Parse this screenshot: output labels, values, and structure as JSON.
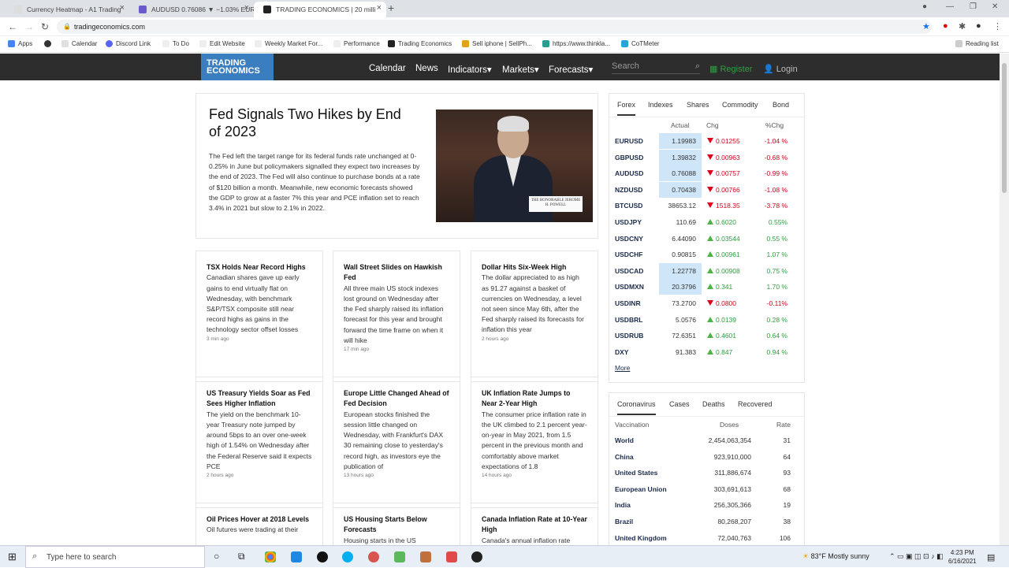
{
  "browser": {
    "tabs": [
      {
        "title": "Currency Heatmap - A1 Trading"
      },
      {
        "title": "AUDUSD 0.76086 ▼ −1.03% EUR"
      },
      {
        "title": "TRADING ECONOMICS | 20 milli"
      }
    ],
    "url": "tradingeconomics.com",
    "bookmarks": [
      "Apps",
      "Calendar",
      "Discord Link",
      "To Do",
      "Edit Website",
      "Weekly Market For...",
      "Performance",
      "Trading Economics",
      "Sell iphone | SellPh...",
      "https://www.thinkla...",
      "CoTMeter",
      "Reading list"
    ]
  },
  "site": {
    "logo_line1": "TRADING",
    "logo_line2": "ECONOMICS",
    "nav": [
      "Calendar",
      "News",
      "Indicators",
      "Markets",
      "Forecasts"
    ],
    "search_placeholder": "Search",
    "register": "Register",
    "login": "Login"
  },
  "headline": {
    "title": "Fed Signals Two Hikes by End of 2023",
    "body": "The Fed left the target range for its federal funds rate unchanged at 0-0.25% in June but policymakers signalled they expect two increases by the end of 2023. The Fed will also continue to purchase bonds at a rate of $120 billion a month. Meanwhile, new economic forecasts showed the GDP to grow at a faster 7% this year and PCE inflation set to reach 3.4% in 2021 but slow to 2.1% in 2022.",
    "nameplate": "THE HONORABLE JEROME H. POWELL"
  },
  "cards": [
    {
      "title": "TSX Holds Near Record Highs",
      "body": "Canadian shares gave up early gains to end virtually flat on Wednesday, with benchmark S&P/TSX composite still near record highs as gains in the technology sector offset losses",
      "ago": "3 min ago"
    },
    {
      "title": "Wall Street Slides on Hawkish Fed",
      "body": "All three main US stock indexes lost ground on Wednesday after the Fed sharply raised its inflation forecast for this year and brought forward the time frame on when it will hike",
      "ago": "17 min ago"
    },
    {
      "title": "Dollar Hits Six-Week High",
      "body": "The dollar appreciated to as high as 91.27 against a basket of currencies on Wednesday, a level not seen since May 6th, after the Fed sharply raised its forecasts for inflation this year",
      "ago": "2 hours ago"
    },
    {
      "title": "US Treasury Yields Soar as Fed Sees Higher Inflation",
      "body": "The yield on the benchmark 10-year Treasury note jumped by around 5bps to an over one-week high of 1.54% on Wednesday after the Federal Reserve said it expects PCE",
      "ago": "2 hours ago"
    },
    {
      "title": "Europe Little Changed Ahead of Fed Decision",
      "body": "European stocks finished the session little changed on Wednesday, with Frankfurt's DAX 30 remaining close to yesterday's record high, as investors eye the publication of",
      "ago": "13 hours ago"
    },
    {
      "title": "UK Inflation Rate Jumps to Near 2-Year High",
      "body": "The consumer price inflation rate in the UK climbed to 2.1 percent year-on-year in May 2021, from 1.5 percent in the previous month and comfortably above market expectations of 1.8",
      "ago": "14 hours ago"
    },
    {
      "title": "Oil Prices Hover at 2018 Levels",
      "body": "Oil futures were trading at their",
      "ago": ""
    },
    {
      "title": "US Housing Starts Below Forecasts",
      "body": "Housing starts in the US",
      "ago": ""
    },
    {
      "title": "Canada Inflation Rate at 10-Year High",
      "body": "Canada's annual inflation rate",
      "ago": ""
    }
  ],
  "forex": {
    "tabs": [
      "Forex",
      "Indexes",
      "Shares",
      "Commodity",
      "Bond"
    ],
    "columns": [
      "Actual",
      "Chg",
      "%Chg"
    ],
    "rows": [
      {
        "sym": "EURUSD",
        "actual": "1.19983",
        "chg": "0.01255",
        "pct": "-1.04 %",
        "dir": "down",
        "hl": true
      },
      {
        "sym": "GBPUSD",
        "actual": "1.39832",
        "chg": "0.00963",
        "pct": "-0.68 %",
        "dir": "down",
        "hl": true
      },
      {
        "sym": "AUDUSD",
        "actual": "0.76088",
        "chg": "0.00757",
        "pct": "-0.99 %",
        "dir": "down",
        "hl": true
      },
      {
        "sym": "NZDUSD",
        "actual": "0.70438",
        "chg": "0.00766",
        "pct": "-1.08 %",
        "dir": "down",
        "hl": true
      },
      {
        "sym": "BTCUSD",
        "actual": "38653.12",
        "chg": "1518.35",
        "pct": "-3.78 %",
        "dir": "down",
        "hl": false
      },
      {
        "sym": "USDJPY",
        "actual": "110.69",
        "chg": "0.6020",
        "pct": "0.55%",
        "dir": "up",
        "hl": false
      },
      {
        "sym": "USDCNY",
        "actual": "6.44090",
        "chg": "0.03544",
        "pct": "0.55 %",
        "dir": "up",
        "hl": false
      },
      {
        "sym": "USDCHF",
        "actual": "0.90815",
        "chg": "0.00961",
        "pct": "1.07 %",
        "dir": "up",
        "hl": false
      },
      {
        "sym": "USDCAD",
        "actual": "1.22778",
        "chg": "0.00908",
        "pct": "0.75 %",
        "dir": "up",
        "hl": true
      },
      {
        "sym": "USDMXN",
        "actual": "20.3796",
        "chg": "0.341",
        "pct": "1.70 %",
        "dir": "up",
        "hl": true
      },
      {
        "sym": "USDINR",
        "actual": "73.2700",
        "chg": "0.0800",
        "pct": "-0.11%",
        "dir": "down",
        "hl": false
      },
      {
        "sym": "USDBRL",
        "actual": "5.0576",
        "chg": "0.0139",
        "pct": "0.28 %",
        "dir": "up",
        "hl": false
      },
      {
        "sym": "USDRUB",
        "actual": "72.6351",
        "chg": "0.4601",
        "pct": "0.64 %",
        "dir": "up",
        "hl": false
      },
      {
        "sym": "DXY",
        "actual": "91.383",
        "chg": "0.847",
        "pct": "0.94 %",
        "dir": "up",
        "hl": false
      }
    ],
    "more": "More"
  },
  "covid": {
    "tabs": [
      "Coronavirus",
      "Cases",
      "Deaths",
      "Recovered"
    ],
    "columns": [
      "Vaccination",
      "Doses",
      "Rate"
    ],
    "rows": [
      {
        "country": "World",
        "doses": "2,454,063,354",
        "rate": "31"
      },
      {
        "country": "China",
        "doses": "923,910,000",
        "rate": "64"
      },
      {
        "country": "United States",
        "doses": "311,886,674",
        "rate": "93"
      },
      {
        "country": "European Union",
        "doses": "303,691,613",
        "rate": "68"
      },
      {
        "country": "India",
        "doses": "256,305,366",
        "rate": "19"
      },
      {
        "country": "Brazil",
        "doses": "80,268,207",
        "rate": "38"
      },
      {
        "country": "United Kingdom",
        "doses": "72,040,763",
        "rate": "106"
      }
    ]
  },
  "taskbar": {
    "search_placeholder": "Type here to search",
    "weather": "83°F  Mostly sunny",
    "time": "4:23 PM",
    "date": "6/16/2021"
  }
}
